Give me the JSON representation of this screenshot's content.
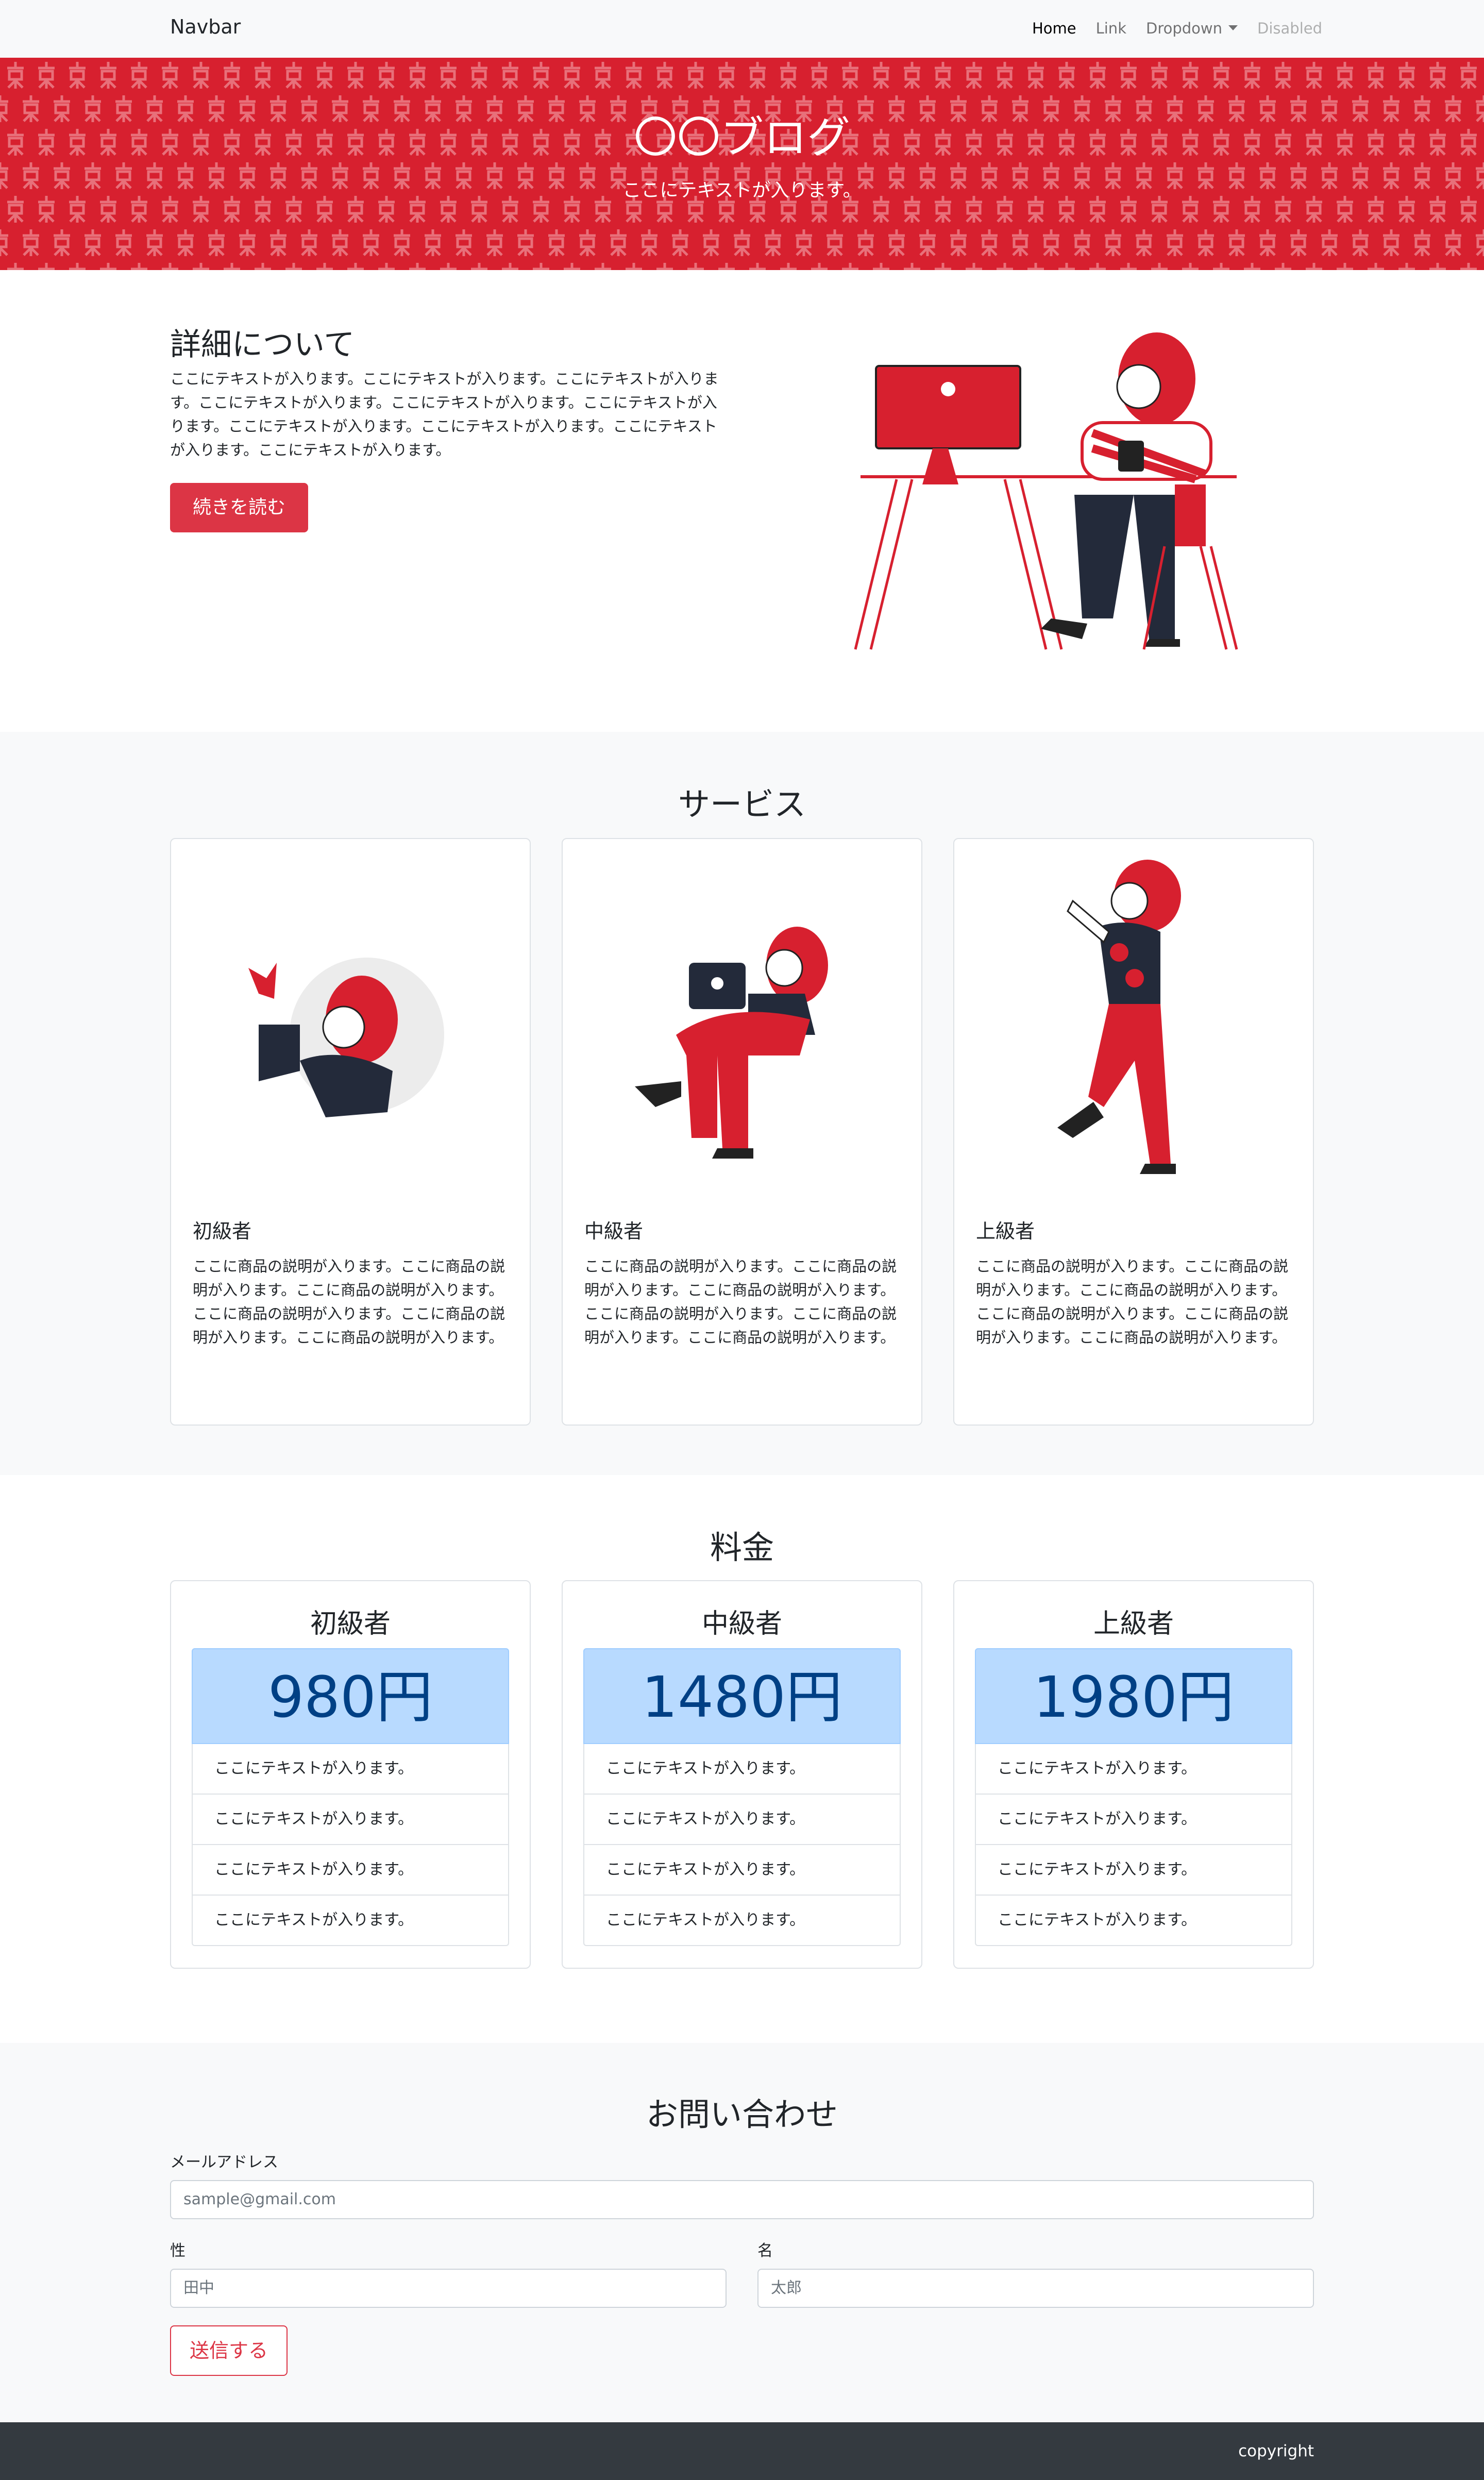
{
  "navbar": {
    "brand": "Navbar",
    "items": [
      {
        "label": "Home",
        "state": "active"
      },
      {
        "label": "Link",
        "state": "normal"
      },
      {
        "label": "Dropdown",
        "state": "dropdown"
      },
      {
        "label": "Disabled",
        "state": "disabled"
      }
    ]
  },
  "hero": {
    "title": "〇〇ブログ",
    "subtitle": "ここにテキストが入ります。"
  },
  "about": {
    "title": "詳細について",
    "text": "ここにテキストが入ります。ここにテキストが入ります。ここにテキストが入ります。ここにテキストが入ります。ここにテキストが入ります。ここにテキストが入ります。ここにテキストが入ります。ここにテキストが入ります。ここにテキストが入ります。ここにテキストが入ります。",
    "button": "続きを読む"
  },
  "services": {
    "title": "サービス",
    "cards": [
      {
        "name": "初級者",
        "desc": "ここに商品の説明が入ります。ここに商品の説明が入ります。ここに商品の説明が入ります。ここに商品の説明が入ります。ここに商品の説明が入ります。ここに商品の説明が入ります。"
      },
      {
        "name": "中級者",
        "desc": "ここに商品の説明が入ります。ここに商品の説明が入ります。ここに商品の説明が入ります。ここに商品の説明が入ります。ここに商品の説明が入ります。ここに商品の説明が入ります。"
      },
      {
        "name": "上級者",
        "desc": "ここに商品の説明が入ります。ここに商品の説明が入ります。ここに商品の説明が入ります。ここに商品の説明が入ります。ここに商品の説明が入ります。ここに商品の説明が入ります。"
      }
    ]
  },
  "pricing": {
    "title": "料金",
    "plans": [
      {
        "name": "初級者",
        "price": "980円",
        "features": [
          "ここにテキストが入ります。",
          "ここにテキストが入ります。",
          "ここにテキストが入ります。",
          "ここにテキストが入ります。"
        ]
      },
      {
        "name": "中級者",
        "price": "1480円",
        "features": [
          "ここにテキストが入ります。",
          "ここにテキストが入ります。",
          "ここにテキストが入ります。",
          "ここにテキストが入ります。"
        ]
      },
      {
        "name": "上級者",
        "price": "1980円",
        "features": [
          "ここにテキストが入ります。",
          "ここにテキストが入ります。",
          "ここにテキストが入ります。",
          "ここにテキストが入ります。"
        ]
      }
    ]
  },
  "contact": {
    "title": "お問い合わせ",
    "email_label": "メールアドレス",
    "email_placeholder": "sample@gmail.com",
    "last_name_label": "性",
    "last_name_placeholder": "田中",
    "first_name_label": "名",
    "first_name_placeholder": "太郎",
    "submit": "送信する"
  },
  "footer": {
    "copyright": "copyright"
  },
  "colors": {
    "primary_red": "#dc3545",
    "hero_red": "#d7202f",
    "dark": "#343a40",
    "price_bg": "#b8daff",
    "price_text": "#004085"
  }
}
